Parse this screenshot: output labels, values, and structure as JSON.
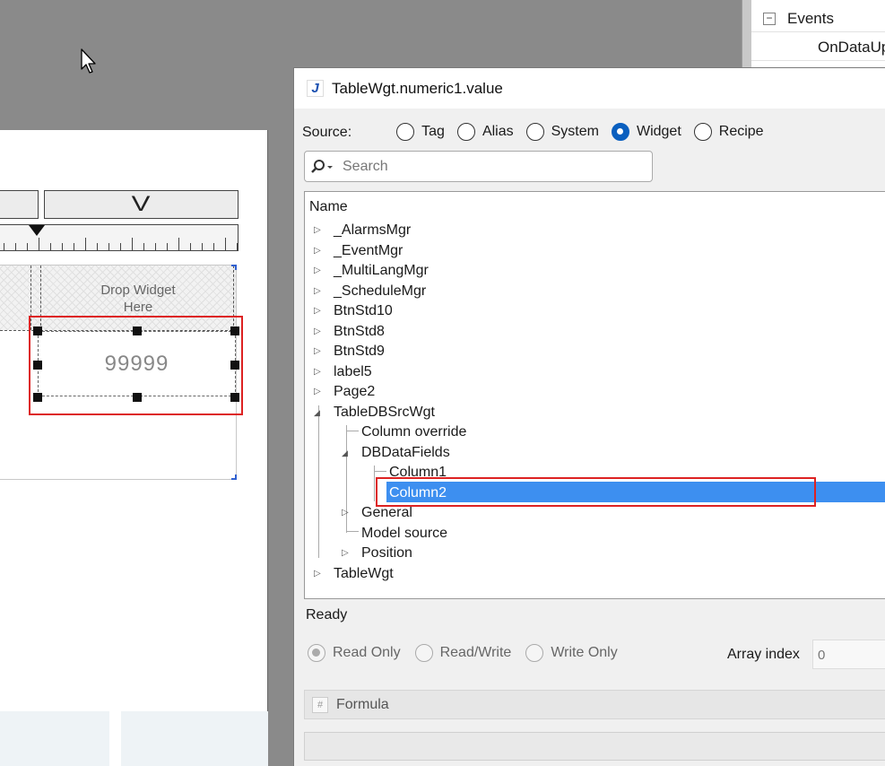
{
  "property_panel": {
    "expander_symbol": "−",
    "events_label": "Events",
    "event_item": "OnDataUpd"
  },
  "canvas": {
    "toggle_glyph": "V",
    "drop_zone_text": "Drop Widget\nHere",
    "numeric_value": "99999"
  },
  "dialog": {
    "title": "TableWgt.numeric1.value",
    "app_icon_letter": "J",
    "source_label": "Source:",
    "source_options": [
      "Tag",
      "Alias",
      "System",
      "Widget",
      "Recipe"
    ],
    "source_selected": "Widget",
    "search_placeholder": "Search",
    "tree_header": "Name",
    "tree_items": [
      {
        "label": "_AlarmsMgr",
        "expander": "collapsed"
      },
      {
        "label": "_EventMgr",
        "expander": "collapsed"
      },
      {
        "label": "_MultiLangMgr",
        "expander": "collapsed"
      },
      {
        "label": "_ScheduleMgr",
        "expander": "collapsed"
      },
      {
        "label": "BtnStd10",
        "expander": "collapsed"
      },
      {
        "label": "BtnStd8",
        "expander": "collapsed"
      },
      {
        "label": "BtnStd9",
        "expander": "collapsed"
      },
      {
        "label": "label5",
        "expander": "collapsed"
      },
      {
        "label": "Page2",
        "expander": "collapsed"
      },
      {
        "label": "TableDBSrcWgt",
        "expander": "expanded"
      },
      {
        "label": "Column override",
        "expander": "none"
      },
      {
        "label": "DBDataFields",
        "expander": "expanded"
      },
      {
        "label": "Column1",
        "expander": "none"
      },
      {
        "label": "Column2",
        "expander": "none",
        "selected": true
      },
      {
        "label": "General",
        "expander": "collapsed"
      },
      {
        "label": "Model source",
        "expander": "none"
      },
      {
        "label": "Position",
        "expander": "collapsed"
      },
      {
        "label": "TableWgt",
        "expander": "collapsed"
      }
    ],
    "status": "Ready",
    "access_options": [
      "Read Only",
      "Read/Write",
      "Write Only"
    ],
    "access_selected": "Read Only",
    "array_index_label": "Array index",
    "array_index_value": "0",
    "formula_icon": "#",
    "formula_label": "Formula"
  },
  "colors": {
    "selection": "#3d8ff0",
    "highlight_border": "#dd2222",
    "radio_checked": "#0a5fbf"
  }
}
